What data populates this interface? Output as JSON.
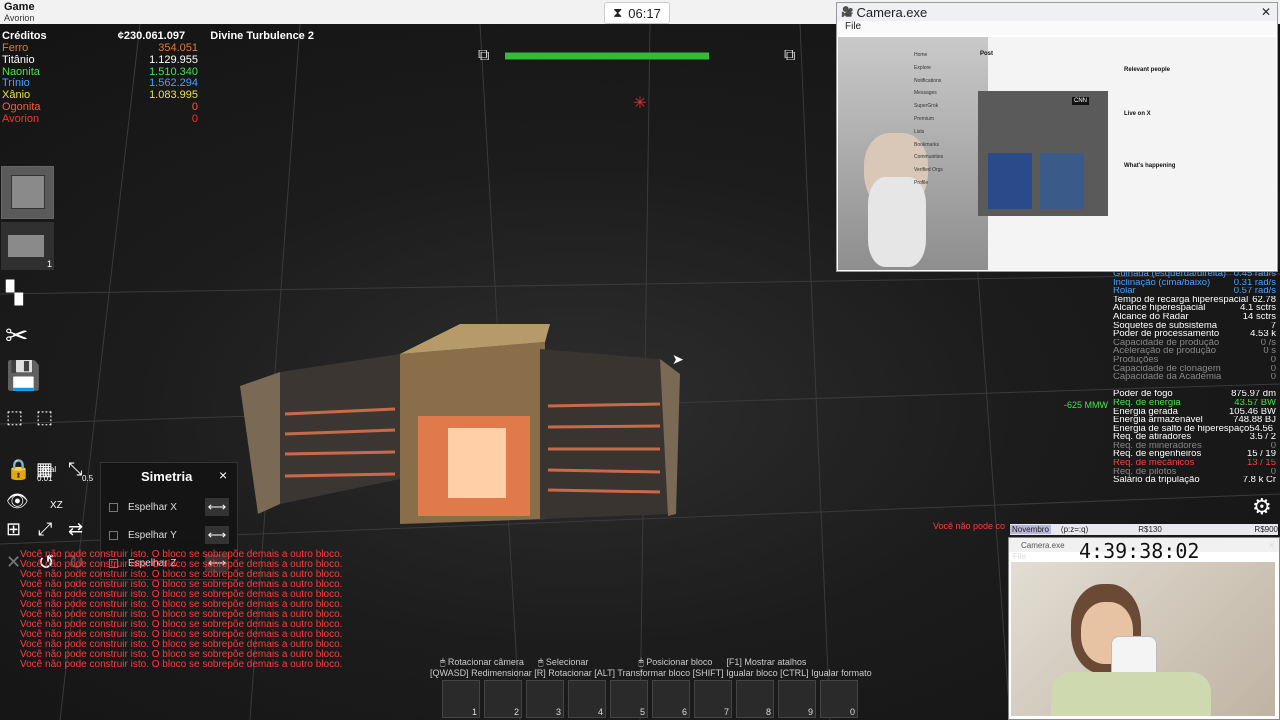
{
  "window": {
    "app_title": "Game",
    "subtitle": "Avorion"
  },
  "timer": {
    "value": "06:17"
  },
  "resources": {
    "credits_label": "Créditos",
    "credits_value": "¢230.061.097",
    "ship_name": "Divine Turbulence 2",
    "items": [
      {
        "name": "Ferro",
        "value": "354.051",
        "color": "#e07a3a"
      },
      {
        "name": "Titânio",
        "value": "1.129.955",
        "color": "#ffffff"
      },
      {
        "name": "Naonita",
        "value": "1.510.340",
        "color": "#4ce04c"
      },
      {
        "name": "Trínio",
        "value": "1.562.294",
        "color": "#4aa0ff"
      },
      {
        "name": "Xânio",
        "value": "1.083.995",
        "color": "#e8e04a"
      },
      {
        "name": "Ogonita",
        "value": "0",
        "color": "#ff5a3a"
      },
      {
        "name": "Avorion",
        "value": "0",
        "color": "#ff3030"
      }
    ]
  },
  "tool_badges": {
    "count": "1",
    "grid_top": "Local",
    "grid_val": "0.01",
    "step": "0.5",
    "axis": "XZ"
  },
  "symmetry": {
    "title": "Simetria",
    "close": "×",
    "options": [
      "Espelhar X",
      "Espelhar Y",
      "Espelhar Z"
    ],
    "arrow": "⟷"
  },
  "errors": [
    "Você não pode construir isto. O bloco se sobrepõe demais a outro bloco.",
    "Você não pode construir isto. O bloco se sobrepõe demais a outro bloco.",
    "Você não pode construir isto. O bloco se sobrepõe demais a outro bloco.",
    "Você não pode construir isto. O bloco se sobrepõe demais a outro bloco.",
    "Você não pode construir isto. O bloco se sobrepõe demais a outro bloco.",
    "Você não pode construir isto. O bloco se sobrepõe demais a outro bloco.",
    "Você não pode construir isto. O bloco se sobrepõe demais a outro bloco.",
    "Você não pode construir isto. O bloco se sobrepõe demais a outro bloco.",
    "Você não pode construir isto. O bloco se sobrepõe demais a outro bloco.",
    "Você não pode construir isto. O bloco se sobrepõe demais a outro bloco.",
    "Você não pode construir isto. O bloco se sobrepõe demais a outro bloco.",
    "Você não pode construir isto. O bloco se sobrepõe demais a outro bloco."
  ],
  "error_right": "Você não pode co",
  "hints": {
    "line1": [
      "Rotacionar câmera",
      "Selecionar",
      "Posicionar bloco",
      "[F1] Mostrar atalhos"
    ],
    "line2": "[QWASD] Redimensionar   [R] Rotacionar   [ALT] Transformar bloco   [SHIFT] Igualar bloco   [CTRL] Igualar formato"
  },
  "hotbar": [
    "1",
    "2",
    "3",
    "4",
    "5",
    "6",
    "7",
    "8",
    "9",
    "0"
  ],
  "energy_marker": "-625 MMW",
  "stats": [
    {
      "label": "Guinada (esquerda/direita)",
      "value": "0.45 rad/s",
      "color": "#4aa0ff"
    },
    {
      "label": "Inclinação (cima/baixo)",
      "value": "0.31 rad/s",
      "color": "#4aa0ff"
    },
    {
      "label": "Rolar",
      "value": "0.57 rad/s",
      "color": "#4aa0ff"
    },
    {
      "label": "Tempo de recarga hiperespacial",
      "value": "62.78",
      "color": "#ffffff"
    },
    {
      "label": "Alcance hiperespacial",
      "value": "4.1 sctrs",
      "color": "#ffffff"
    },
    {
      "label": "Alcance do Radar",
      "value": "14 sctrs",
      "color": "#ffffff"
    },
    {
      "label": "Soquetes de subsistema",
      "value": "7",
      "color": "#ffffff"
    },
    {
      "label": "Poder de processamento",
      "value": "4.53 k",
      "color": "#ffffff"
    },
    {
      "label": "Capacidade de produção",
      "value": "0 /s",
      "color": "#888888"
    },
    {
      "label": "Aceleração de produção",
      "value": "0 s",
      "color": "#888888"
    },
    {
      "label": "Produções",
      "value": "0",
      "color": "#888888"
    },
    {
      "label": "Capacidade de clonagem",
      "value": "0",
      "color": "#888888"
    },
    {
      "label": "Capacidade da Academia",
      "value": "0",
      "color": "#888888"
    },
    {
      "label": "",
      "value": "",
      "color": "#888888"
    },
    {
      "label": "Poder de fogo",
      "value": "875.97 dm",
      "color": "#ffffff"
    },
    {
      "label": "Req. de energia",
      "value": "43.57 BW",
      "color": "#4ce04c"
    },
    {
      "label": "Energia gerada",
      "value": "105.46 BW",
      "color": "#ffffff"
    },
    {
      "label": "Energia armazenável",
      "value": "748.88 BJ",
      "color": "#ffffff"
    },
    {
      "label": "Energia de salto de hiperespaço",
      "value": "54.56 BJ",
      "color": "#ffffff"
    },
    {
      "label": "Req. de atiradores",
      "value": "3.5 / 2",
      "color": "#ffffff"
    },
    {
      "label": "Req. de mineradores",
      "value": "0",
      "color": "#888888"
    },
    {
      "label": "Req. de engenheiros",
      "value": "15 / 19",
      "color": "#ffffff"
    },
    {
      "label": "Req. de mecânicos",
      "value": "13 / 15",
      "color": "#ff4040"
    },
    {
      "label": "Req. de pilotos",
      "value": "0",
      "color": "#888888"
    },
    {
      "label": "Salário da tripulação",
      "value": "7.8 k Cr",
      "color": "#ffffff"
    }
  ],
  "camera": {
    "title": "Camera.exe",
    "menu": "File"
  },
  "camera2": {
    "title": "Camera.exe",
    "menu": "File",
    "timer": "4:39:38:02",
    "month": "Novembro",
    "mode": "(p:z=:q)",
    "price1": "R$130",
    "price2": "R$900"
  },
  "browser": {
    "nav": [
      "Home",
      "Explore",
      "Notifications",
      "Messages",
      "SuperGrok",
      "Premium",
      "Lists",
      "Bookmarks",
      "Communities",
      "Verified Orgs",
      "Profile"
    ],
    "post_header": "Post",
    "relevant": "Relevant people",
    "live": "Live on X",
    "happening": "What's happening",
    "badge": "CNN"
  }
}
